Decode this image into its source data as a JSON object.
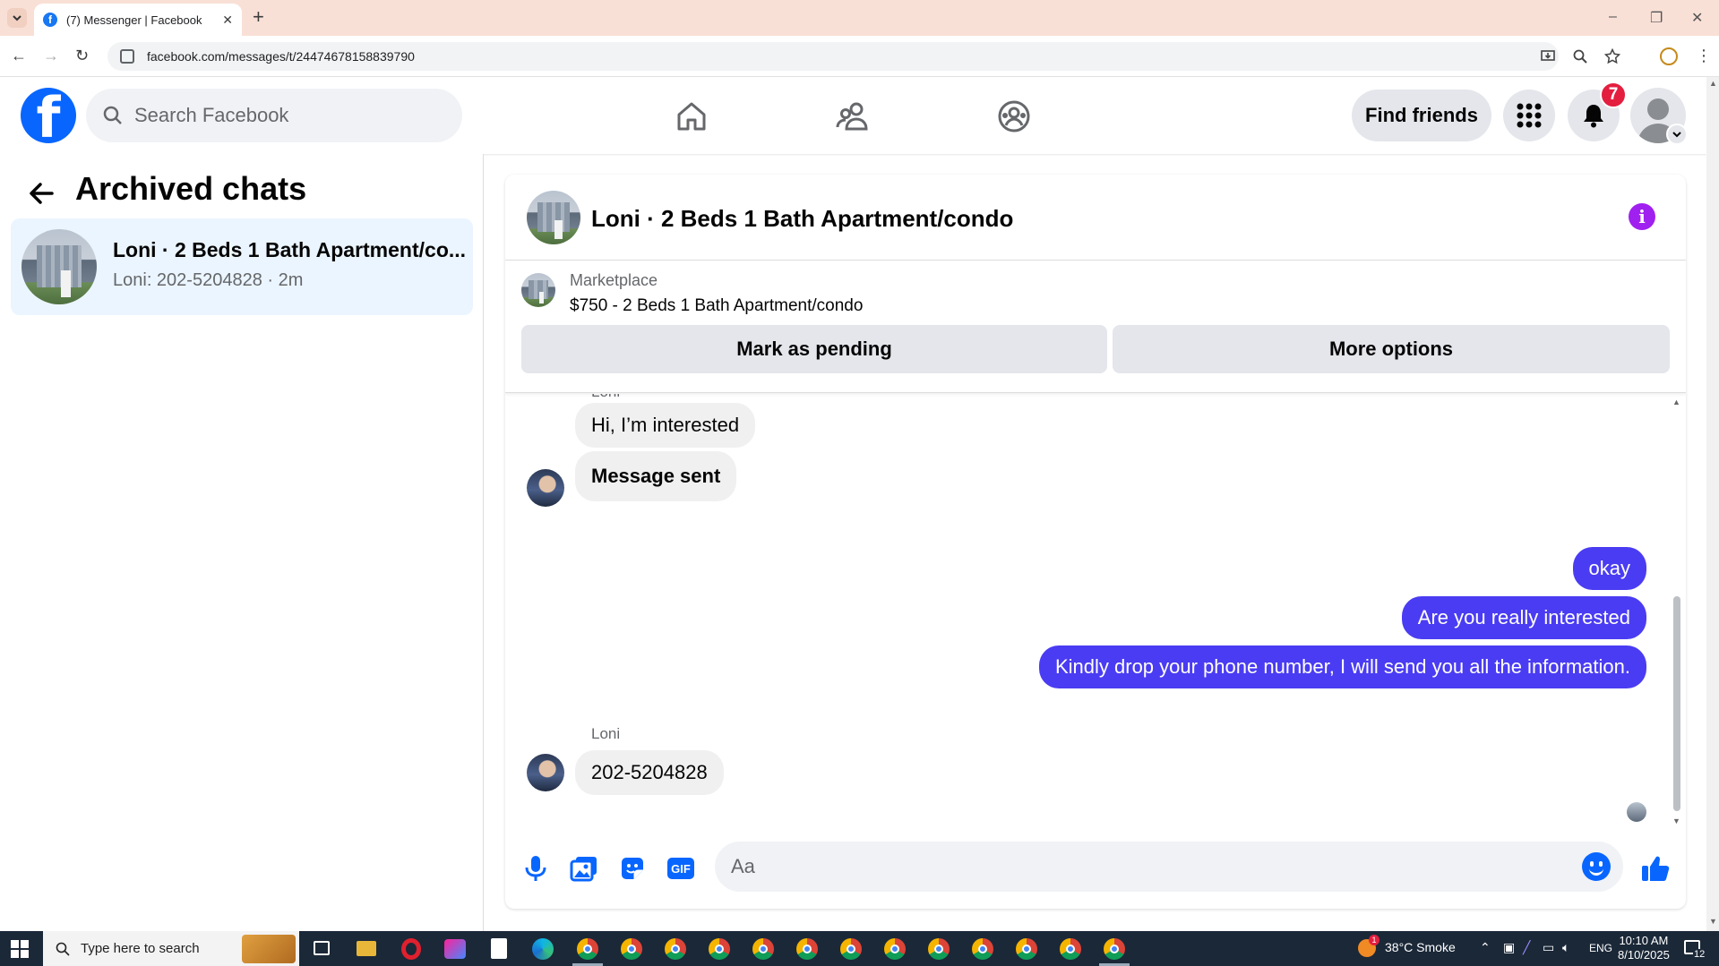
{
  "browser": {
    "tab_title": "(7) Messenger | Facebook",
    "url": "facebook.com/messages/t/24474678158839790",
    "favicon_letter": "f"
  },
  "header": {
    "logo_letter": "f",
    "search_placeholder": "Search Facebook",
    "nav_icons": [
      "home-icon",
      "friends-icon",
      "groups-icon"
    ],
    "find_friends_label": "Find friends",
    "notifications_count": "7",
    "accent_color": "#0866ff"
  },
  "left_panel": {
    "title": "Archived chats",
    "chats": [
      {
        "name": "Loni · 2 Beds 1 Bath Apartment/co...",
        "preview": "Loni: 202-5204828 · 2m",
        "selected": true
      }
    ]
  },
  "conversation": {
    "title": "Loni · 2 Beds 1 Bath Apartment/condo",
    "marketplace_label": "Marketplace",
    "listing": "$750 - 2 Beds 1 Bath Apartment/condo",
    "mark_pending_label": "Mark as pending",
    "more_options_label": "More options",
    "messages": [
      {
        "from": "them",
        "sender": "Loni",
        "text": "Hi, I’m interested"
      },
      {
        "from": "them",
        "text": "Message sent"
      },
      {
        "from": "me",
        "text": "okay"
      },
      {
        "from": "me",
        "text": "Are you really interested"
      },
      {
        "from": "me",
        "text": "Kindly drop your phone number, I will send you all the information."
      },
      {
        "from": "them",
        "sender": "Loni",
        "text": "202-5204828"
      }
    ],
    "composer_placeholder": "Aa",
    "gif_label": "GIF",
    "outgoing_bubble_color": "#4a3cf2"
  },
  "taskbar": {
    "search_placeholder": "Type here to search",
    "weather": "38°C  Smoke",
    "weather_alert": "1",
    "language": "ENG",
    "time": "10:10 AM",
    "date": "8/10/2025",
    "notification_count": "12"
  }
}
